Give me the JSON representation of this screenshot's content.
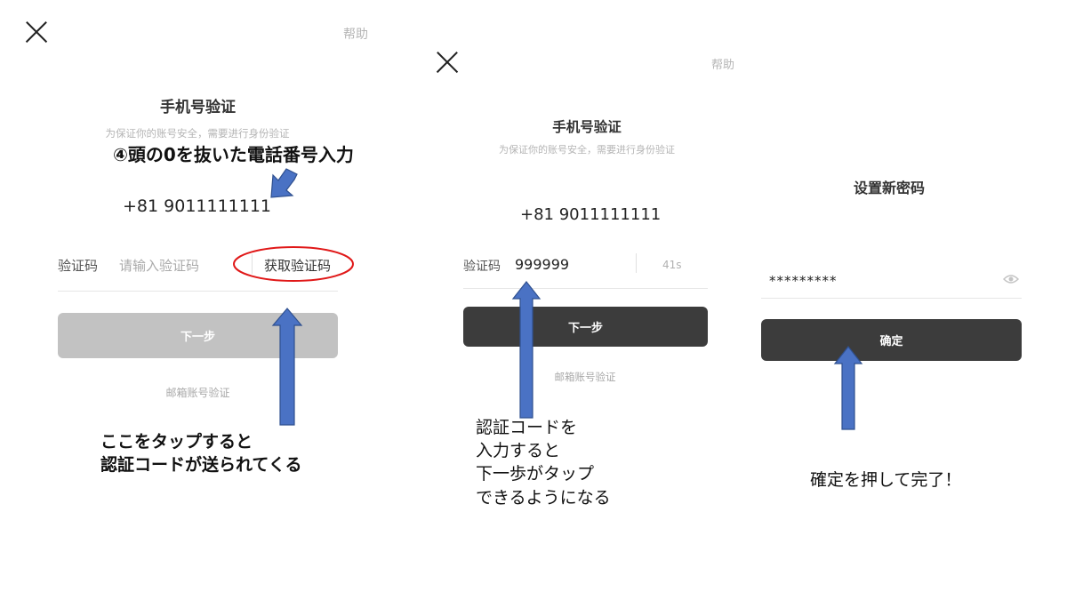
{
  "colors": {
    "arrow_fill": "#4a72c4",
    "arrow_stroke": "#2f508f",
    "highlight_circle": "#e01818",
    "button_dark": "#3c3c3c",
    "button_disabled": "#c2c2c2"
  },
  "screen1": {
    "close_icon": "close-icon",
    "help": "帮助",
    "title": "手机号验证",
    "subtitle": "为保证你的账号安全，需要进行身份验证",
    "phone": "+81  9011111111",
    "code_label": "验证码",
    "code_placeholder": "请输入验证码",
    "get_code": "获取验证码",
    "next": "下一步",
    "email_verify": "邮箱账号验证"
  },
  "screen2": {
    "close_icon": "close-icon",
    "help": "帮助",
    "title": "手机号验证",
    "subtitle": "为保证你的账号安全，需要进行身份验证",
    "phone": "+81  9011111111",
    "code_label": "验证码",
    "code_value": "999999",
    "countdown": "41s",
    "next": "下一步",
    "email_verify": "邮箱账号验证"
  },
  "screen3": {
    "title": "设置新密码",
    "password_value": "*********",
    "eye_icon": "eye-icon",
    "confirm": "确定"
  },
  "annotations": {
    "phone_note": "④頭の0を抜いた電話番号入力",
    "tap_note_1": "ここをタップすると",
    "tap_note_2": "認証コードが送られてくる",
    "code_note_1": "認証コードを",
    "code_note_2": "入力すると",
    "code_note_3": "下一歩がタップ",
    "code_note_4": "できるようになる",
    "done_note": "確定を押して完了！"
  }
}
